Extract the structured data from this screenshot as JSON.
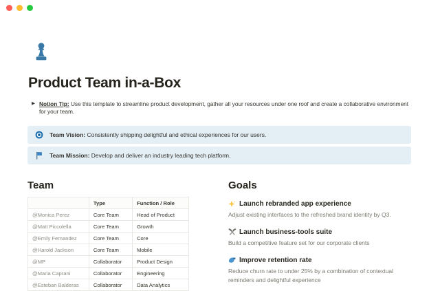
{
  "window": {
    "buttons": [
      {
        "name": "close",
        "color": "#ff5f57"
      },
      {
        "name": "minimize",
        "color": "#febc2e"
      },
      {
        "name": "zoom",
        "color": "#28c840"
      }
    ]
  },
  "page": {
    "icon": "chess-pawn",
    "icon_color": "#3879a7",
    "title": "Product Team in-a-Box",
    "tip": {
      "toggle_glyph": "▶",
      "label": "Notion Tip:",
      "text": "Use this template to streamline product development, gather all your resources under one roof and create a collaborative environment for your team."
    },
    "callouts": [
      {
        "icon": "target",
        "label": "Team Vision:",
        "text": "Consistently shipping delightful and ethical experiences for our users.",
        "bg": "#e3eef5"
      },
      {
        "icon": "blue-flag",
        "label": "Team Mission:",
        "text": "Develop and deliver an industry leading tech platform.",
        "bg": "#e3eef5"
      }
    ]
  },
  "team": {
    "heading": "Team",
    "table": {
      "headers": [
        "",
        "Type",
        "Function / Role"
      ],
      "rows": [
        [
          "@Monica Perez",
          "Core Team",
          "Head of Product"
        ],
        [
          "@Matt Piccolella",
          "Core Team",
          "Growth"
        ],
        [
          "@Emily Fernandez",
          "Core Team",
          "Core"
        ],
        [
          "@Harold Jackson",
          "Core Team",
          "Mobile"
        ],
        [
          "@MP",
          "Collaborator",
          "Product Design"
        ],
        [
          "@Maria Caprani",
          "Collaborator",
          "Engineering"
        ],
        [
          "@Esteban Balderas",
          "Collaborator",
          "Data Analytics"
        ]
      ]
    }
  },
  "goals": {
    "heading": "Goals",
    "items": [
      {
        "icon": "sparkles",
        "title": "Launch rebranded app experience",
        "description": "Adjust existing interfaces to the refreshed brand identity by Q3."
      },
      {
        "icon": "hammer-and-pick",
        "title": "Launch business-tools suite",
        "description": "Build a competitive feature set for our corporate clients"
      },
      {
        "icon": "mechanical-arm",
        "title": "Improve retention rate",
        "description": "Reduce churn rate to under 25% by a combination of contextual reminders and delightful experience"
      }
    ]
  },
  "colors": {
    "accent_blue": "#3879a7",
    "callout_bg": "#e3eef5",
    "text_primary": "#37352f",
    "text_gray": "#8d8b85",
    "table_border": "#e8e7e4"
  }
}
